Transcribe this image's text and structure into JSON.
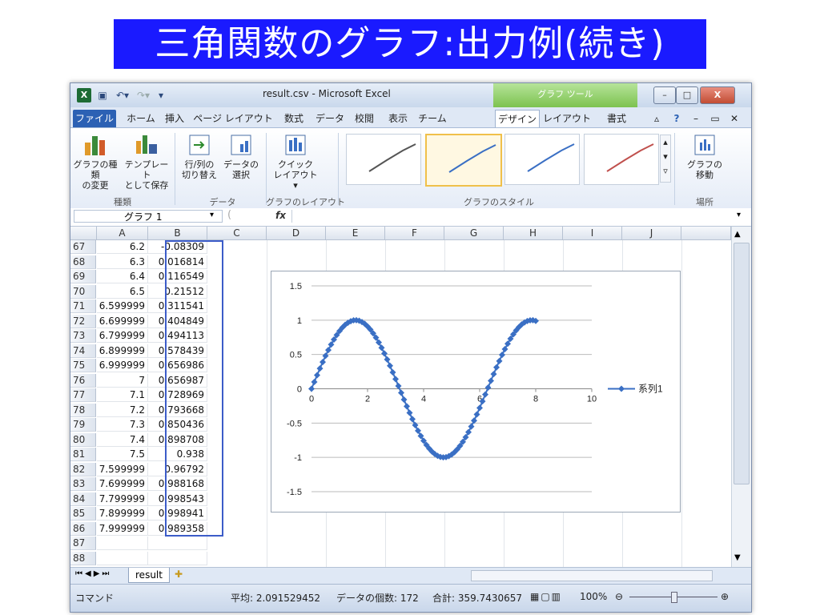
{
  "slide": {
    "title": "三角関数のグラフ:出力例(続き)"
  },
  "window": {
    "title": "result.csv - Microsoft Excel",
    "chart_tools": "グラフ ツール",
    "app_icon": "X",
    "buttons": {
      "minimize": "–",
      "maximize": "□",
      "close": "X"
    }
  },
  "tabs": [
    "ファイル",
    "ホーム",
    "挿入",
    "ページ レイアウト",
    "数式",
    "データ",
    "校閲",
    "表示",
    "チーム",
    "デザイン",
    "レイアウト",
    "書式"
  ],
  "ribbon": {
    "buttons": {
      "change_type": "グラフの種類\nの変更",
      "save_template": "テンプレート\nとして保存",
      "switch_rowcol": "行/列の\n切り替え",
      "select_data": "データの\n選択",
      "quick_layout": "クイック\nレイアウト ▾",
      "move_chart": "グラフの\n移動"
    },
    "groups": {
      "type": "種類",
      "data": "データ",
      "layouts": "グラフのレイアウト",
      "styles": "グラフのスタイル",
      "location": "場所"
    },
    "style_colors": [
      "#555555",
      "#3a6fc4",
      "#3a6fc4",
      "#c0504d"
    ]
  },
  "formula_bar": {
    "name_box": "グラフ 1",
    "fx": "fx"
  },
  "columns": [
    "A",
    "B",
    "C",
    "D",
    "E",
    "F",
    "G",
    "H",
    "I",
    "J"
  ],
  "rows": [
    {
      "n": "67",
      "a": "6.2",
      "b": "-0.08309"
    },
    {
      "n": "68",
      "a": "6.3",
      "b": "0.016814"
    },
    {
      "n": "69",
      "a": "6.4",
      "b": "0.116549"
    },
    {
      "n": "70",
      "a": "6.5",
      "b": "0.21512"
    },
    {
      "n": "71",
      "a": "6.599999",
      "b": "0.311541"
    },
    {
      "n": "72",
      "a": "6.699999",
      "b": "0.404849"
    },
    {
      "n": "73",
      "a": "6.799999",
      "b": "0.494113"
    },
    {
      "n": "74",
      "a": "6.899999",
      "b": "0.578439"
    },
    {
      "n": "75",
      "a": "6.999999",
      "b": "0.656986"
    },
    {
      "n": "76",
      "a": "7",
      "b": "0.656987"
    },
    {
      "n": "77",
      "a": "7.1",
      "b": "0.728969"
    },
    {
      "n": "78",
      "a": "7.2",
      "b": "0.793668"
    },
    {
      "n": "79",
      "a": "7.3",
      "b": "0.850436"
    },
    {
      "n": "80",
      "a": "7.4",
      "b": "0.898708"
    },
    {
      "n": "81",
      "a": "7.5",
      "b": "0.938"
    },
    {
      "n": "82",
      "a": "7.599999",
      "b": "0.96792"
    },
    {
      "n": "83",
      "a": "7.699999",
      "b": "0.988168"
    },
    {
      "n": "84",
      "a": "7.799999",
      "b": "0.998543"
    },
    {
      "n": "85",
      "a": "7.899999",
      "b": "0.998941"
    },
    {
      "n": "86",
      "a": "7.999999",
      "b": "0.989358"
    },
    {
      "n": "87",
      "a": "",
      "b": ""
    },
    {
      "n": "88",
      "a": "",
      "b": ""
    }
  ],
  "sheet": {
    "tab": "result"
  },
  "status": {
    "mode": "コマンド",
    "average": "平均: 2.091529452",
    "count": "データの個数: 172",
    "sum": "合計: 359.7430657",
    "zoom": "100%"
  },
  "chart_data": {
    "type": "line",
    "series": [
      {
        "name": "系列1",
        "color": "#3a6fc4",
        "function": "sin(x)",
        "x_start": 0,
        "x_end": 8,
        "x_step": 0.1
      }
    ],
    "title": "",
    "xlabel": "",
    "ylabel": "",
    "xlim": [
      0,
      10
    ],
    "ylim": [
      -1.5,
      1.5
    ],
    "xticks": [
      "0",
      "2",
      "4",
      "6",
      "8",
      "10"
    ],
    "yticks": [
      "1.5",
      "1",
      "0.5",
      "0",
      "-0.5",
      "-1",
      "-1.5"
    ],
    "grid": true,
    "legend": "right"
  }
}
